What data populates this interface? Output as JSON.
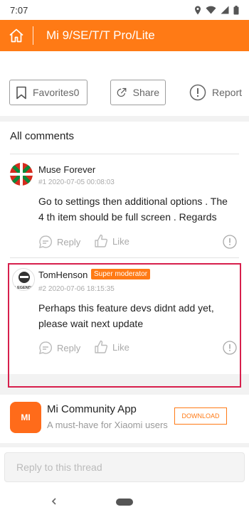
{
  "status_bar": {
    "time": "7:07"
  },
  "header": {
    "title": "Mi 9/SE/T/T Pro/Lite"
  },
  "actions": {
    "favorites_label": "Favorites",
    "favorites_count": "0",
    "share_label": "Share",
    "report_label": "Report"
  },
  "comments_section": {
    "title": "All comments",
    "comments": [
      {
        "username": "Muse Forever",
        "meta": "#1 2020-07-05 00:08:03",
        "content": "Go to settings then additional options . The 4 th item should be full screen . Regards",
        "reply_label": "Reply",
        "like_label": "Like"
      },
      {
        "username": "TomHenson",
        "badge": "Super moderator",
        "meta": "#2 2020-07-06 18:15:35",
        "content": "Perhaps this feature devs didnt add yet, please wait next update",
        "reply_label": "Reply",
        "like_label": "Like",
        "avatar_text": "LEGENDS"
      }
    ]
  },
  "promo": {
    "logo_text": "MI",
    "title": "Mi Community App",
    "subtitle": "A must-have for Xiaomi users",
    "download_label": "DOWNLOAD"
  },
  "reply_box": {
    "placeholder": "Reply to this thread"
  },
  "colors": {
    "accent": "#ff7a15",
    "highlight": "#d71f4c",
    "band": "#f2f2f2"
  }
}
